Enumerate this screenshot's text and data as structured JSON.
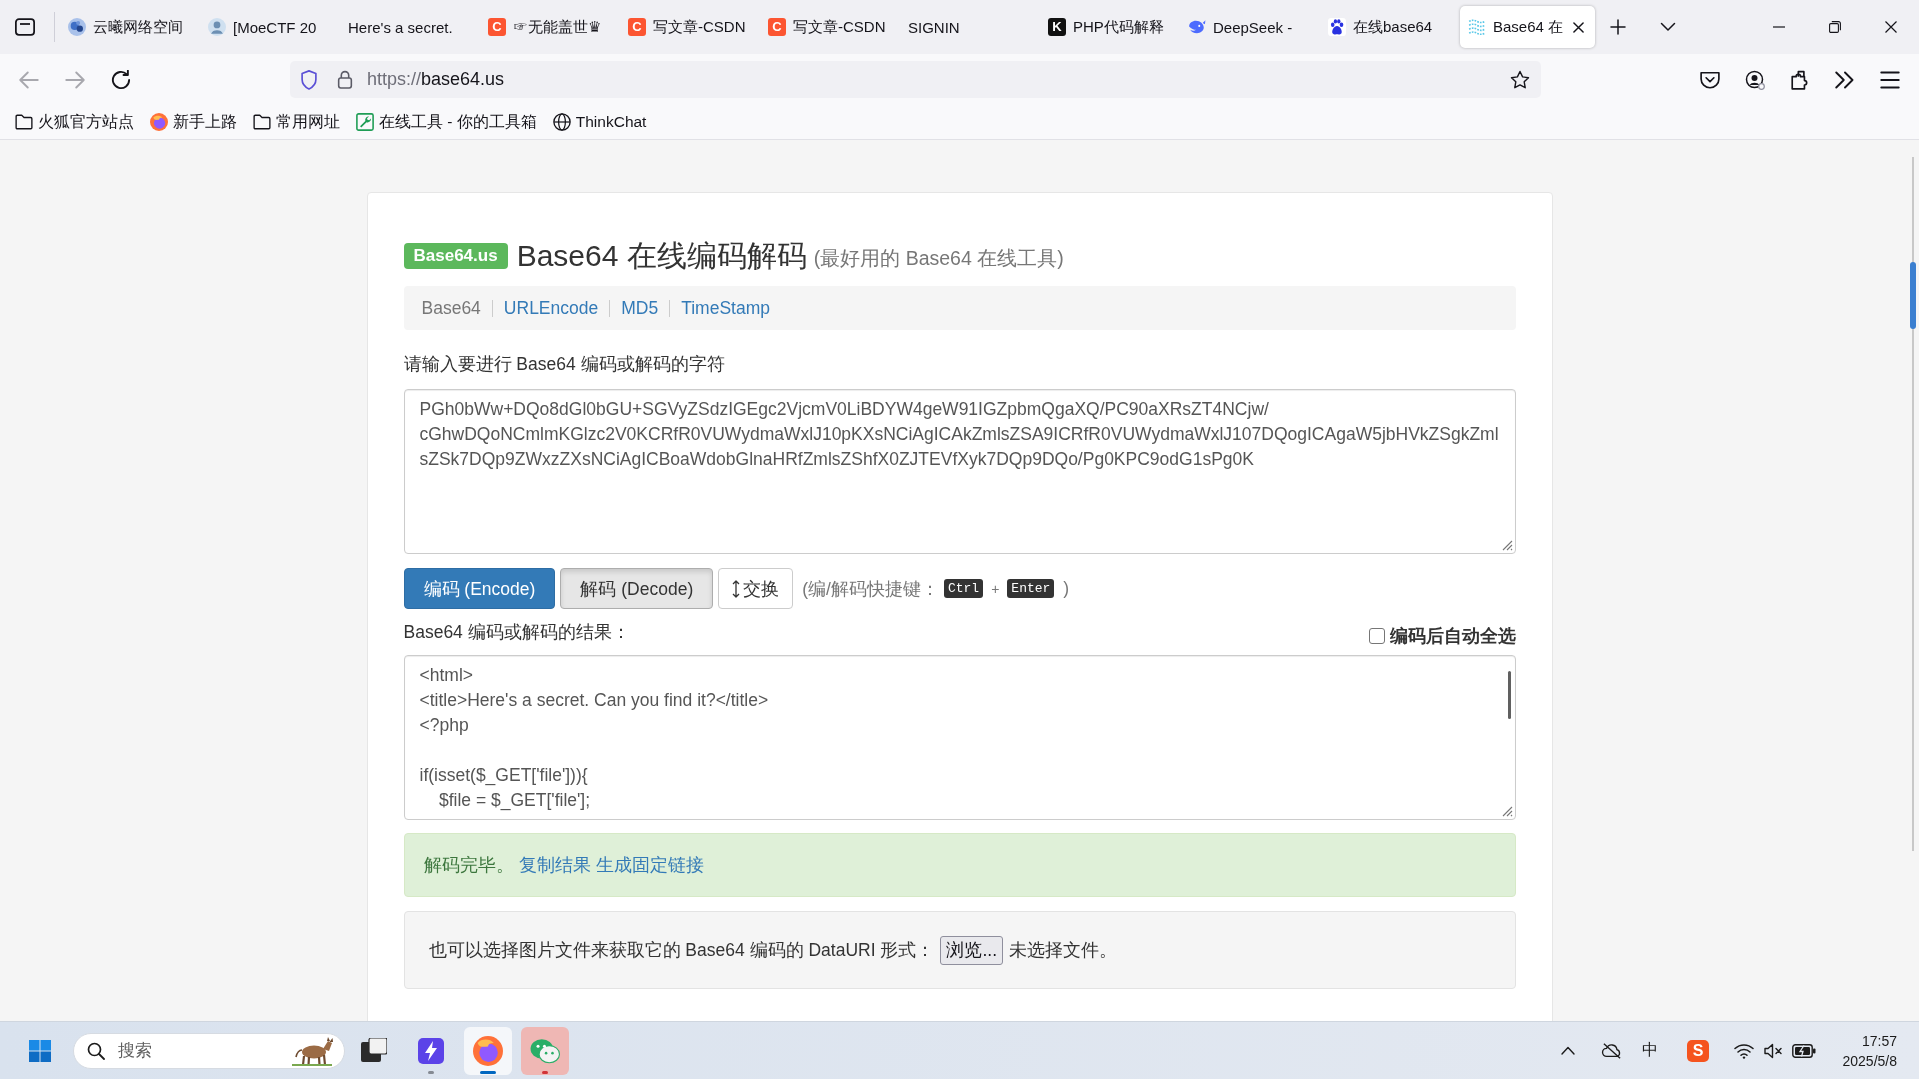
{
  "browser": {
    "tabs": [
      {
        "title": "云曦网络空间",
        "icon": {
          "kind": "blob"
        },
        "selected": false
      },
      {
        "title": "[MoeCTF 20",
        "icon": {
          "kind": "avatar"
        },
        "selected": false
      },
      {
        "title": "Here's a secret.",
        "selected": false
      },
      {
        "title": "☞无能盖世♛",
        "icon": {
          "kind": "letter",
          "glyph": "C",
          "color": "#fc5531"
        },
        "selected": false
      },
      {
        "title": "写文章-CSDN",
        "icon": {
          "kind": "letter",
          "glyph": "C",
          "color": "#fc5531"
        },
        "selected": false
      },
      {
        "title": "写文章-CSDN",
        "icon": {
          "kind": "letter",
          "glyph": "C",
          "color": "#fc5531"
        },
        "selected": false
      },
      {
        "title": "SIGNIN",
        "selected": false
      },
      {
        "title": "PHP代码解释",
        "icon": {
          "kind": "letter",
          "glyph": "K",
          "color": "#111111"
        },
        "selected": false
      },
      {
        "title": "DeepSeek -",
        "icon": {
          "kind": "whale"
        },
        "selected": false
      },
      {
        "title": "在线base64",
        "icon": {
          "kind": "paw"
        },
        "selected": false
      },
      {
        "title": "Base64 在",
        "icon": {
          "kind": "waves"
        },
        "selected": true
      }
    ],
    "nav_buttons": [
      {
        "kind": "back",
        "disabled": true
      },
      {
        "kind": "forward",
        "disabled": true
      },
      {
        "kind": "reload",
        "disabled": false
      }
    ],
    "address_bar": {
      "scheme": "https://",
      "host": "base64.us"
    },
    "bookmarks": [
      {
        "label": "火狐官方站点",
        "kind": "folder"
      },
      {
        "label": "新手上路",
        "kind": "browser"
      },
      {
        "label": "常用网址",
        "kind": "folder"
      },
      {
        "label": "在线工具 - 你的工具箱",
        "kind": "tool"
      },
      {
        "label": "ThinkChat",
        "kind": "globe"
      }
    ]
  },
  "page": {
    "badge": "Base64.us",
    "title": "Base64 在线编码解码",
    "subtitle": "(最好用的 Base64 在线工具)",
    "nav": [
      {
        "label": "Base64",
        "selected": true
      },
      {
        "label": "URLEncode",
        "selected": false
      },
      {
        "label": "MD5",
        "selected": false
      },
      {
        "label": "TimeStamp",
        "selected": false
      }
    ],
    "input": {
      "label": "请输入要进行 Base64 编码或解码的字符",
      "value": "PGh0bWw+DQo8dGl0bGU+SGVyZSdzIGEgc2VjcmV0LiBDYW4geW91IGZpbmQgaXQ/PC90aXRsZT4NCjw/cGhwDQoNCmlmKGlzc2V0KCRfR0VUWydmaWxlJ10pKXsNCiAgICAkZmlsZSA9ICRfR0VUWydmaWxlJ107DQogICAgaW5jbHVkZSgkZmlsZSk7DQp9ZWxzZXsNCiAgICBoaWdobGlnaHRfZmlsZShfX0ZJTEVfXyk7DQp9DQo/Pg0KPC9odG1sPg0K"
    },
    "buttons": [
      {
        "label": "编码 (Encode)",
        "kind": "primary",
        "pressed": false
      },
      {
        "label": "解码 (Decode)",
        "kind": "default",
        "pressed": true
      },
      {
        "label": "交换",
        "kind": "swap",
        "pressed": false
      }
    ],
    "shortcut_hint": {
      "prefix": "(编/解码快捷键：",
      "keys": [
        "Ctrl",
        "Enter"
      ],
      "joiner": "+",
      "suffix": ")"
    },
    "output": {
      "label": "Base64 编码或解码的结果：",
      "auto_select": {
        "label": "编码后自动全选",
        "checked": false
      },
      "value": "<html>\n<title>Here's a secret. Can you find it?</title>\n<?php\n\nif(isset($_GET['file'])){\n    $file = $_GET['file'];"
    },
    "status": {
      "message": "解码完毕。",
      "links": [
        "复制结果",
        "生成固定链接"
      ]
    },
    "file_picker": {
      "prompt": "也可以选择图片文件来获取它的 Base64 编码的 DataURI 形式：",
      "button": "浏览...",
      "file_status": "未选择文件。"
    }
  },
  "taskbar": {
    "search": {
      "placeholder": "搜索"
    },
    "apps": [
      {
        "kind": "window",
        "running": false,
        "focused": false,
        "alert": false
      },
      {
        "kind": "bolt",
        "running": true,
        "focused": false,
        "alert": false
      },
      {
        "kind": "browser",
        "running": true,
        "focused": true,
        "alert": false
      },
      {
        "kind": "chat",
        "running": true,
        "focused": false,
        "alert": true
      }
    ],
    "tray": {
      "ime": "中",
      "ime_app": "S",
      "muted": true
    },
    "clock": {
      "time": "17:57",
      "date": "2025/5/8"
    }
  }
}
